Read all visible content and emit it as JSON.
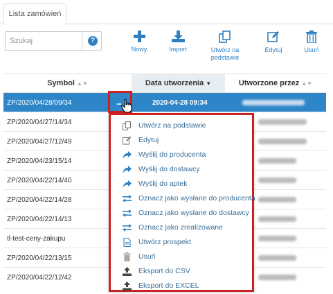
{
  "tab": {
    "label": "Lista zamówień"
  },
  "search": {
    "placeholder": "Szukaj",
    "help_glyph": "?"
  },
  "toolbar": {
    "new_label": "Nowy",
    "import_label": "Import",
    "create_from_label_1": "Utwórz na",
    "create_from_label_2": "podstawie",
    "edit_label": "Edytuj",
    "delete_label": "Usuń"
  },
  "table": {
    "columns": {
      "symbol": "Symbol",
      "date": "Data utworzenia",
      "creator": "Utworzone przez"
    },
    "rows": [
      {
        "symbol": "ZP/2020/04/28/09/34",
        "date": "2020-04-28 09:34"
      },
      {
        "symbol": "ZP/2020/04/27/14/34"
      },
      {
        "symbol": "ZP/2020/04/27/12/49"
      },
      {
        "symbol": "ZP/2020/04/23/15/14"
      },
      {
        "symbol": "ZP/2020/04/22/14/40"
      },
      {
        "symbol": "ZP/2020/04/22/14/28"
      },
      {
        "symbol": "ZP/2020/04/22/14/13"
      },
      {
        "symbol": "tl-test-ceny-zakupu"
      },
      {
        "symbol": "ZP/2020/04/22/13/15"
      },
      {
        "symbol": "ZP/2020/04/22/12/42"
      }
    ]
  },
  "row_menu": {
    "trigger": "...",
    "items": [
      {
        "label": "Utwórz na podstawie",
        "icon": "copy-icon"
      },
      {
        "label": "Edytuj",
        "icon": "edit-icon"
      },
      {
        "label": "Wyślij do producenta",
        "icon": "share-arrow-icon"
      },
      {
        "label": "Wyślij do dostawcy",
        "icon": "share-arrow-icon"
      },
      {
        "label": "Wyślij do aptek",
        "icon": "share-arrow-icon"
      },
      {
        "label": "Oznacz jako wysłane do producenta",
        "icon": "exchange-icon"
      },
      {
        "label": "Oznacz jako wysłane do dostawcy",
        "icon": "exchange-icon"
      },
      {
        "label": "Oznacz jako zrealizowane",
        "icon": "exchange-icon"
      },
      {
        "label": "Utwórz prospekt",
        "icon": "document-icon"
      },
      {
        "label": "Usuń",
        "icon": "trash-icon"
      },
      {
        "label": "Eksport do CSV",
        "icon": "upload-icon"
      },
      {
        "label": "Eksport do EXCEL",
        "icon": "upload-icon"
      }
    ]
  },
  "colors": {
    "accent": "#2f80c3",
    "selected_row": "#2e86c9",
    "highlight_frame": "#cc1f1f",
    "menu_text": "#3a6d96"
  }
}
